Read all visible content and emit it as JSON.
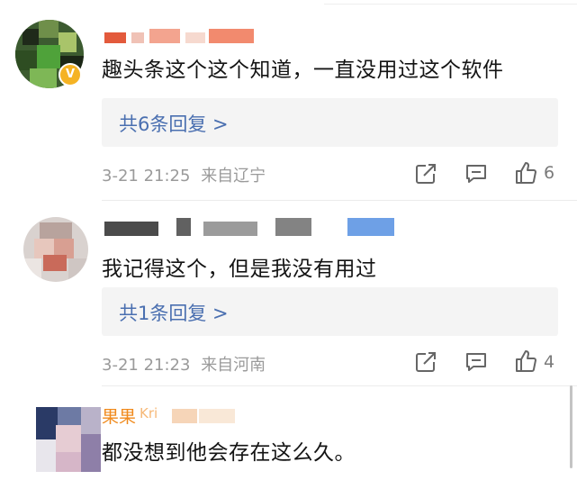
{
  "comments": [
    {
      "text": "趣头条这个这个知道，一直没用过这个软件",
      "reply_label": "共6条回复 >",
      "time": "3-21 21:25",
      "location": "来自辽宁",
      "likes": "6"
    },
    {
      "text": "我记得这个，但是我没有用过",
      "reply_label": "共1条回复 >",
      "time": "3-21 21:23",
      "location": "来自河南",
      "likes": "4"
    },
    {
      "text": "都没想到他会存在这么久。",
      "username_visible": "果果",
      "username_tail": "Kri"
    }
  ],
  "colors": {
    "reply_link": "#4a6fb0",
    "meta": "#9a9a9a",
    "verified_badge": "#f5b324",
    "username_orange": "#f08a1c"
  }
}
